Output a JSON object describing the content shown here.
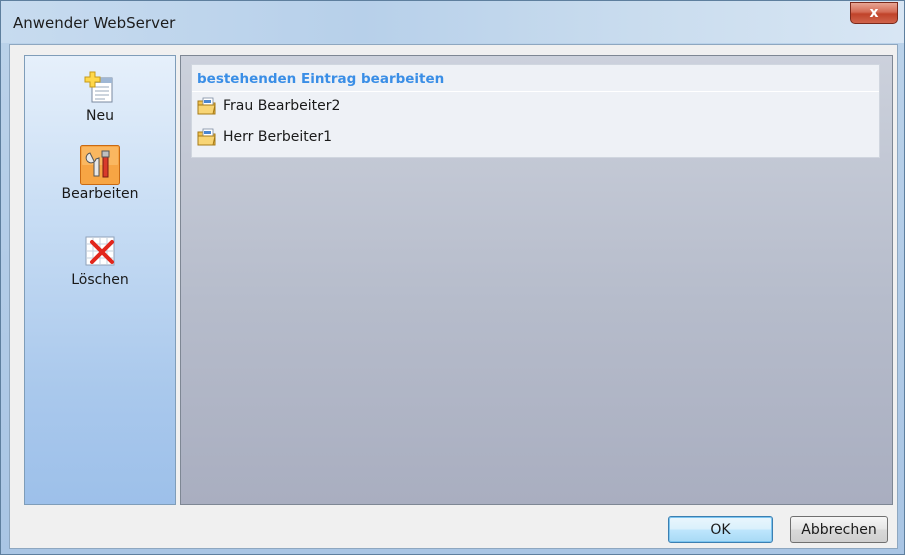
{
  "window": {
    "title": "Anwender WebServer",
    "close_label": "x"
  },
  "sidebar": {
    "items": [
      {
        "label": "Neu",
        "icon": "new-entry-icon",
        "selected": false
      },
      {
        "label": "Bearbeiten",
        "icon": "edit-tools-icon",
        "selected": true
      },
      {
        "label": "Löschen",
        "icon": "delete-entry-icon",
        "selected": false
      }
    ]
  },
  "list": {
    "header": "bestehenden Eintrag bearbeiten",
    "items": [
      {
        "label": "Frau Bearbeiter2",
        "icon": "folder-icon"
      },
      {
        "label": "Herr Berbeiter1",
        "icon": "folder-icon"
      }
    ]
  },
  "footer": {
    "ok_label": "OK",
    "cancel_label": "Abbrechen"
  },
  "colors": {
    "accent": "#3a8ee6",
    "selected_item": "#f7932d"
  }
}
